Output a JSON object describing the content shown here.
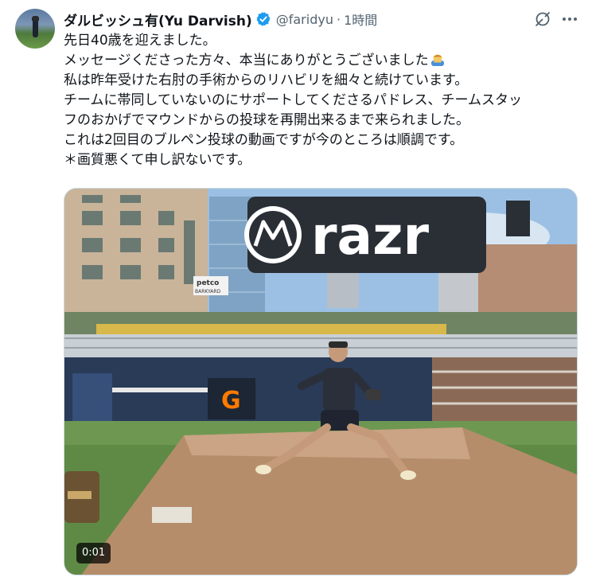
{
  "tweet": {
    "display_name": "ダルビッシュ有(Yu Darvish)",
    "handle": "@faridyu",
    "separator": "·",
    "time": "1時間",
    "lines": [
      "先日40歳を迎えました。",
      "メッセージくださった方々、本当にありがとうございました",
      "私は昨年受けた右肘の手術からのリハビリを細々と続けています。",
      "チームに帯同していないのにサポートしてくださるパドレス、チームスタッ",
      "フのおかげでマウンドからの投球を再開出来るまで来られました。",
      "これは2回目のブルペン投球の動画ですが今のところは順調です。",
      "＊画質悪くて申し訳ないです。"
    ],
    "emoji": "man-bowing-emoji"
  },
  "video": {
    "time_label": "0:01",
    "scoreboard_text": "razr",
    "sign_text": [
      "petco",
      "BARKYARD"
    ]
  },
  "colors": {
    "verified": "#1d9bf0",
    "text": "#0f1419",
    "muted": "#536471"
  }
}
